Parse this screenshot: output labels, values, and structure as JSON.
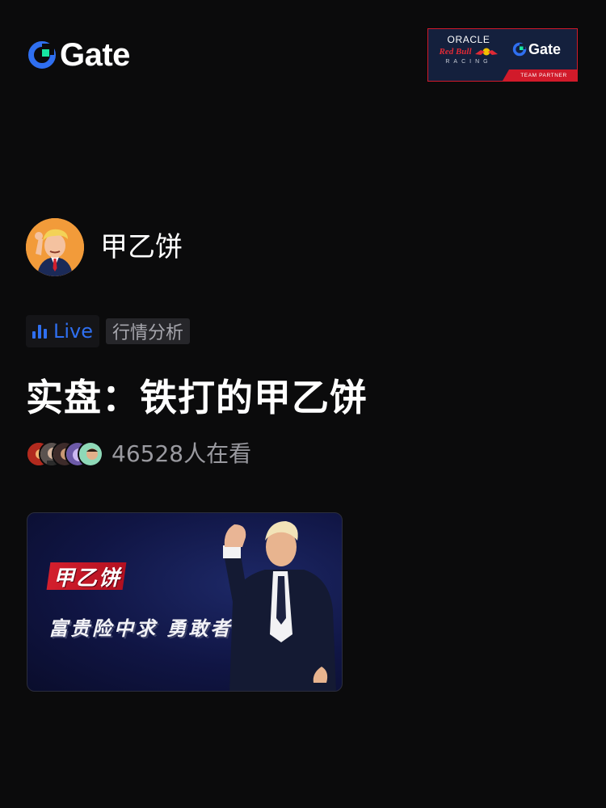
{
  "header": {
    "brand": "Gate",
    "partner_badge": {
      "oracle": "ORACLE",
      "redbull": "Red Bull",
      "racing": "RACING",
      "brand": "Gate",
      "team_partner": "TEAM PARTNER",
      "colors": {
        "background": "#14203d",
        "accent": "#d11a2a"
      }
    }
  },
  "streamer": {
    "name": "甲乙饼",
    "avatar": "cartoon-portrait-avatar"
  },
  "tags": {
    "live": "Live",
    "category": "行情分析"
  },
  "stream": {
    "title": "实盘：铁打的甲乙饼",
    "viewer_count_text": "46528人在看",
    "viewer_avatars": 5
  },
  "cover": {
    "name_banner": "甲乙饼",
    "slogan": "富贵险中求 勇敢者游戏"
  },
  "colors": {
    "background": "#0b0b0c",
    "accent_blue": "#2f6ff0",
    "brand_green": "#17e6a1",
    "muted_text": "#9a9aa0"
  }
}
